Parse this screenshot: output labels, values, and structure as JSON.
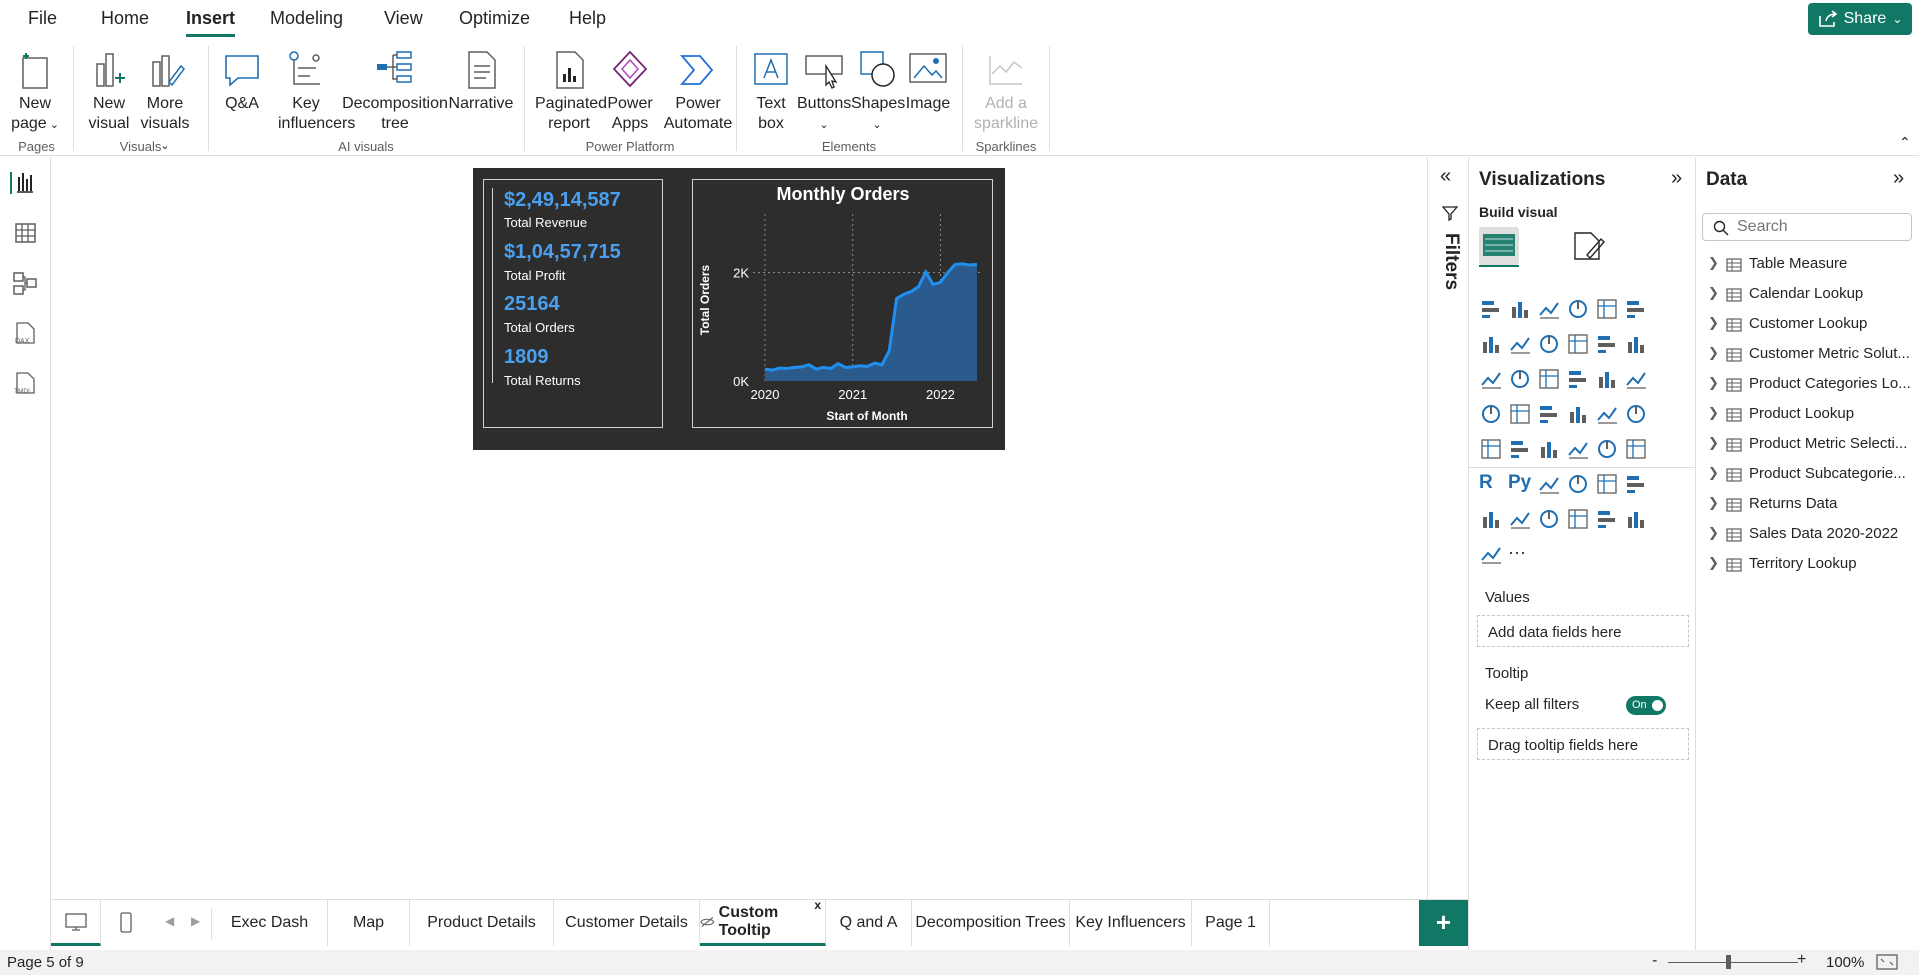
{
  "menubar": {
    "items": [
      "File",
      "Home",
      "Insert",
      "Modeling",
      "View",
      "Optimize",
      "Help"
    ],
    "active": "Insert",
    "share_label": "Share"
  },
  "ribbon": {
    "new_page": [
      "New",
      "page"
    ],
    "new_visual": [
      "New",
      "visual"
    ],
    "more_visuals": [
      "More",
      "visuals"
    ],
    "qa": "Q&A",
    "key_influencers": [
      "Key",
      "influencers"
    ],
    "decomposition_tree": [
      "Decomposition",
      "tree"
    ],
    "narrative": "Narrative",
    "paginated_report": [
      "Paginated",
      "report"
    ],
    "power_apps": [
      "Power",
      "Apps"
    ],
    "power_automate": [
      "Power",
      "Automate"
    ],
    "text_box": [
      "Text",
      "box"
    ],
    "buttons": "Buttons",
    "shapes": "Shapes",
    "image": "Image",
    "add_sparkline": [
      "Add a",
      "sparkline"
    ],
    "groups": {
      "pages": "Pages",
      "visuals": "Visuals",
      "ai_visuals": "AI visuals",
      "power_platform": "Power Platform",
      "elements": "Elements",
      "sparklines": "Sparklines"
    }
  },
  "tooltip": {
    "kpis": [
      {
        "value": "$2,49,14,587",
        "label": "Total Revenue"
      },
      {
        "value": "$1,04,57,715",
        "label": "Total Profit"
      },
      {
        "value": "25164",
        "label": "Total Orders"
      },
      {
        "value": "1809",
        "label": "Total Returns"
      }
    ]
  },
  "chart_data": {
    "type": "area",
    "title": "Monthly Orders",
    "xlabel": "Start of Month",
    "ylabel": "Total Orders",
    "x_ticks": [
      "2020",
      "2021",
      "2022"
    ],
    "y_ticks": [
      "0K",
      "2K"
    ],
    "ylim": [
      0,
      2600
    ],
    "grid": true,
    "x": [
      "2020-01",
      "2020-02",
      "2020-03",
      "2020-04",
      "2020-05",
      "2020-06",
      "2020-07",
      "2020-08",
      "2020-09",
      "2020-10",
      "2020-11",
      "2020-12",
      "2021-01",
      "2021-02",
      "2021-03",
      "2021-04",
      "2021-05",
      "2021-06",
      "2021-07",
      "2021-08",
      "2021-09",
      "2021-10",
      "2021-11",
      "2021-12",
      "2022-01",
      "2022-02",
      "2022-03",
      "2022-04",
      "2022-05",
      "2022-06"
    ],
    "values": [
      220,
      200,
      240,
      230,
      250,
      260,
      300,
      220,
      250,
      230,
      320,
      250,
      260,
      280,
      270,
      330,
      300,
      560,
      1520,
      1600,
      1650,
      1740,
      2010,
      1780,
      1820,
      2000,
      2150,
      2160,
      2140,
      2150
    ],
    "color": "#1f8ff0",
    "area_color": "#2b5b8c"
  },
  "filters": {
    "label": "Filters"
  },
  "visualizations": {
    "title": "Visualizations",
    "build_visual": "Build visual",
    "values_label": "Values",
    "values_well": "Add data fields here",
    "tooltip_label": "Tooltip",
    "keep_all_filters": "Keep all filters",
    "toggle": "On",
    "tooltip_well": "Drag tooltip fields here",
    "icons": [
      "stacked-bar",
      "stacked-column",
      "clustered-bar",
      "clustered-column",
      "100-stacked-bar",
      "100-stacked-column",
      "line",
      "area",
      "stacked-area",
      "100-stacked-area",
      "line-and-column",
      "line-and-clustered-column",
      "ribbon",
      "waterfall",
      "funnel",
      "scatter",
      "pie",
      "donut",
      "treemap",
      "map",
      "filled-map",
      "shape-map",
      "azure-map",
      "gauge",
      "card",
      "multi-row-card",
      "kpi",
      "slicer",
      "table",
      "matrix",
      "r-visual",
      "python-visual",
      "key-influencers",
      "decomposition-tree",
      "qa",
      "narrative",
      "trophy-metrics",
      "paginated-report",
      "card-new",
      "slicer-new",
      "azure-map-2",
      "power-apps",
      "power-automate",
      "more"
    ],
    "r_label": "R",
    "py_label": "Py",
    "more_label": "···"
  },
  "data": {
    "title": "Data",
    "search_placeholder": "Search",
    "tables": [
      "Table Measure",
      "Calendar Lookup",
      "Customer Lookup",
      "Customer Metric Solut...",
      "Product Categories Lo...",
      "Product Lookup",
      "Product Metric Selecti...",
      "Product Subcategorie...",
      "Returns Data",
      "Sales Data 2020-2022",
      "Territory Lookup"
    ]
  },
  "tabs": {
    "pages": [
      "Exec Dash",
      "Map",
      "Product Details",
      "Customer Details",
      "Custom Tooltip",
      "Q and A",
      "Decomposition Trees",
      "Key Influencers",
      "Page 1"
    ],
    "active_index": 4,
    "close_label": "x",
    "add_label": "+"
  },
  "status": {
    "page_info": "Page 5 of 9",
    "zoom": "100%",
    "minus": "-",
    "plus": "+"
  }
}
